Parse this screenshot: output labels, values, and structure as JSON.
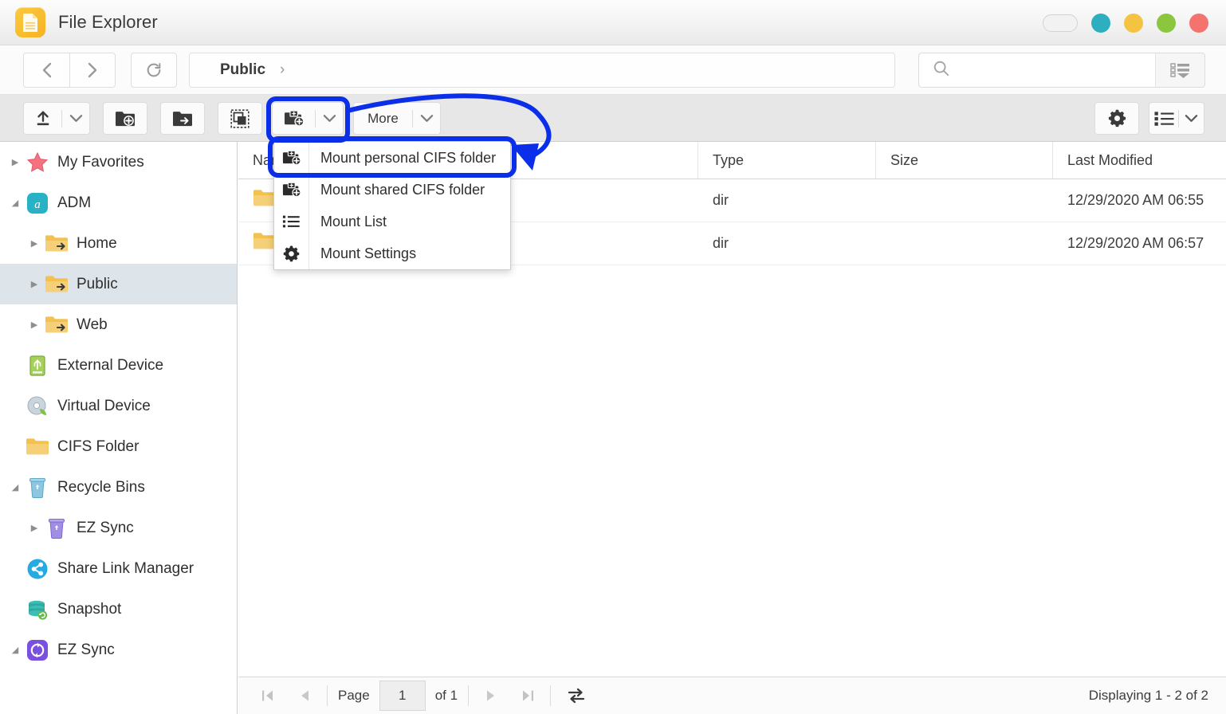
{
  "window": {
    "title": "File Explorer",
    "app_icon": "document-icon",
    "controls": [
      {
        "name": "pill-button",
        "color": "#f2f2f2"
      },
      {
        "name": "minimize-button",
        "color": "#2eafc0"
      },
      {
        "name": "maximize-button",
        "color": "#f5c342"
      },
      {
        "name": "restore-button",
        "color": "#8cc63f"
      },
      {
        "name": "close-button",
        "color": "#f4736e"
      }
    ]
  },
  "nav": {
    "back": "back-icon",
    "forward": "forward-icon",
    "refresh": "refresh-icon",
    "breadcrumb": "Public",
    "breadcrumb_separator": "›"
  },
  "search": {
    "placeholder": "",
    "value": "",
    "icon": "search-icon",
    "advanced_icon": "advanced-search-icon"
  },
  "toolbar": {
    "upload_label": "upload-icon",
    "new_folder_label": "new-folder-icon",
    "move_folder_label": "move-folder-icon",
    "select_label": "select-all-icon",
    "mount_label": "mount-cifs-icon",
    "more_label": "More",
    "settings_label": "gear-icon",
    "view_label": "list-view-icon"
  },
  "menu": {
    "items": [
      {
        "label": "Mount personal CIFS folder",
        "icon": "mount-folder-icon",
        "highlighted": true
      },
      {
        "label": "Mount shared CIFS folder",
        "icon": "mount-folder-icon",
        "highlighted": false
      },
      {
        "label": "Mount List",
        "icon": "list-icon",
        "highlighted": false
      },
      {
        "label": "Mount Settings",
        "icon": "gear-icon",
        "highlighted": false
      }
    ]
  },
  "sidebar": {
    "items": [
      {
        "label": "My Favorites",
        "icon": "star-icon",
        "indent": 0,
        "twisty": "collapsed",
        "selected": false
      },
      {
        "label": "ADM",
        "icon": "adm-icon",
        "indent": 0,
        "twisty": "expanded",
        "selected": false
      },
      {
        "label": "Home",
        "icon": "shared-folder-icon",
        "indent": 1,
        "twisty": "collapsed",
        "selected": false
      },
      {
        "label": "Public",
        "icon": "shared-folder-icon",
        "indent": 1,
        "twisty": "collapsed",
        "selected": true
      },
      {
        "label": "Web",
        "icon": "shared-folder-icon",
        "indent": 1,
        "twisty": "collapsed",
        "selected": false
      },
      {
        "label": "External Device",
        "icon": "usb-device-icon",
        "indent": 1,
        "twisty": "none",
        "selected": false
      },
      {
        "label": "Virtual Device",
        "icon": "disc-icon",
        "indent": 1,
        "twisty": "none",
        "selected": false
      },
      {
        "label": "CIFS Folder",
        "icon": "folder-icon",
        "indent": 1,
        "twisty": "none",
        "selected": false
      },
      {
        "label": "Recycle Bins",
        "icon": "recycle-bin-icon",
        "indent": 0,
        "twisty": "expanded",
        "selected": false
      },
      {
        "label": "EZ Sync",
        "icon": "recycle-bin-purple-icon",
        "indent": 1,
        "twisty": "collapsed",
        "selected": false
      },
      {
        "label": "Share Link Manager",
        "icon": "share-icon",
        "indent": 1,
        "twisty": "none",
        "selected": false
      },
      {
        "label": "Snapshot",
        "icon": "snapshot-icon",
        "indent": 1,
        "twisty": "none",
        "selected": false
      },
      {
        "label": "EZ Sync",
        "icon": "ez-sync-icon",
        "indent": 0,
        "twisty": "expanded",
        "selected": false
      }
    ]
  },
  "filelist": {
    "columns": [
      "Name",
      "Type",
      "Size",
      "Last Modified"
    ],
    "rows": [
      {
        "name": "",
        "type": "dir",
        "size": "",
        "modified": "12/29/2020 AM 06:55",
        "icon": "folder-icon"
      },
      {
        "name": "",
        "type": "dir",
        "size": "",
        "modified": "12/29/2020 AM 06:57",
        "icon": "folder-icon"
      }
    ]
  },
  "status": {
    "first_icon": "first-page-icon",
    "prev_icon": "prev-page-icon",
    "page_label": "Page",
    "page_value": "1",
    "of_label": "of 1",
    "next_icon": "next-page-icon",
    "last_icon": "last-page-icon",
    "refresh_icon": "refresh-list-icon",
    "displaying": "Displaying 1 - 2 of 2"
  },
  "annotation": {
    "color": "#0b2fe8",
    "shapes": [
      "rounded-rect-around-mount-button",
      "curved-arrow",
      "rounded-rect-around-first-menu-item"
    ]
  }
}
